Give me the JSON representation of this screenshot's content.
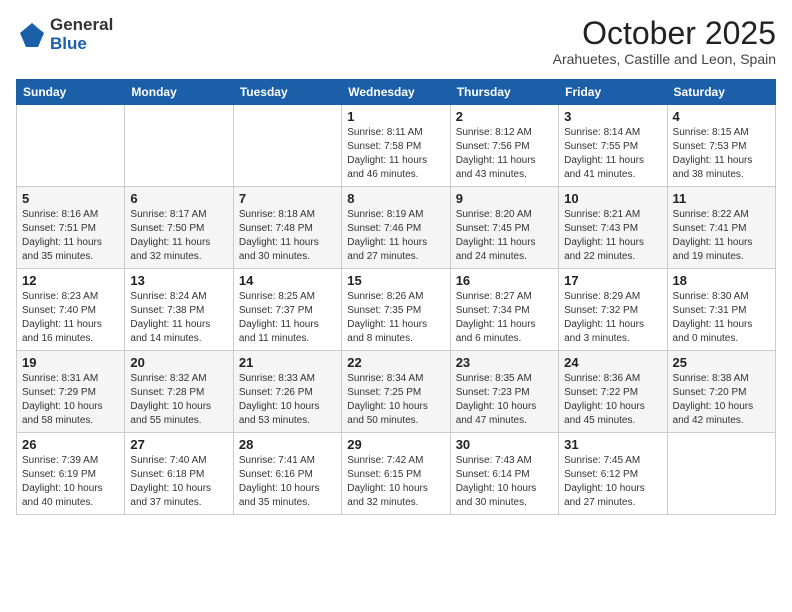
{
  "header": {
    "logo_general": "General",
    "logo_blue": "Blue",
    "month_title": "October 2025",
    "location": "Arahuetes, Castille and Leon, Spain"
  },
  "weekdays": [
    "Sunday",
    "Monday",
    "Tuesday",
    "Wednesday",
    "Thursday",
    "Friday",
    "Saturday"
  ],
  "weeks": [
    [
      {
        "day": "",
        "text": ""
      },
      {
        "day": "",
        "text": ""
      },
      {
        "day": "",
        "text": ""
      },
      {
        "day": "1",
        "text": "Sunrise: 8:11 AM\nSunset: 7:58 PM\nDaylight: 11 hours\nand 46 minutes."
      },
      {
        "day": "2",
        "text": "Sunrise: 8:12 AM\nSunset: 7:56 PM\nDaylight: 11 hours\nand 43 minutes."
      },
      {
        "day": "3",
        "text": "Sunrise: 8:14 AM\nSunset: 7:55 PM\nDaylight: 11 hours\nand 41 minutes."
      },
      {
        "day": "4",
        "text": "Sunrise: 8:15 AM\nSunset: 7:53 PM\nDaylight: 11 hours\nand 38 minutes."
      }
    ],
    [
      {
        "day": "5",
        "text": "Sunrise: 8:16 AM\nSunset: 7:51 PM\nDaylight: 11 hours\nand 35 minutes."
      },
      {
        "day": "6",
        "text": "Sunrise: 8:17 AM\nSunset: 7:50 PM\nDaylight: 11 hours\nand 32 minutes."
      },
      {
        "day": "7",
        "text": "Sunrise: 8:18 AM\nSunset: 7:48 PM\nDaylight: 11 hours\nand 30 minutes."
      },
      {
        "day": "8",
        "text": "Sunrise: 8:19 AM\nSunset: 7:46 PM\nDaylight: 11 hours\nand 27 minutes."
      },
      {
        "day": "9",
        "text": "Sunrise: 8:20 AM\nSunset: 7:45 PM\nDaylight: 11 hours\nand 24 minutes."
      },
      {
        "day": "10",
        "text": "Sunrise: 8:21 AM\nSunset: 7:43 PM\nDaylight: 11 hours\nand 22 minutes."
      },
      {
        "day": "11",
        "text": "Sunrise: 8:22 AM\nSunset: 7:41 PM\nDaylight: 11 hours\nand 19 minutes."
      }
    ],
    [
      {
        "day": "12",
        "text": "Sunrise: 8:23 AM\nSunset: 7:40 PM\nDaylight: 11 hours\nand 16 minutes."
      },
      {
        "day": "13",
        "text": "Sunrise: 8:24 AM\nSunset: 7:38 PM\nDaylight: 11 hours\nand 14 minutes."
      },
      {
        "day": "14",
        "text": "Sunrise: 8:25 AM\nSunset: 7:37 PM\nDaylight: 11 hours\nand 11 minutes."
      },
      {
        "day": "15",
        "text": "Sunrise: 8:26 AM\nSunset: 7:35 PM\nDaylight: 11 hours\nand 8 minutes."
      },
      {
        "day": "16",
        "text": "Sunrise: 8:27 AM\nSunset: 7:34 PM\nDaylight: 11 hours\nand 6 minutes."
      },
      {
        "day": "17",
        "text": "Sunrise: 8:29 AM\nSunset: 7:32 PM\nDaylight: 11 hours\nand 3 minutes."
      },
      {
        "day": "18",
        "text": "Sunrise: 8:30 AM\nSunset: 7:31 PM\nDaylight: 11 hours\nand 0 minutes."
      }
    ],
    [
      {
        "day": "19",
        "text": "Sunrise: 8:31 AM\nSunset: 7:29 PM\nDaylight: 10 hours\nand 58 minutes."
      },
      {
        "day": "20",
        "text": "Sunrise: 8:32 AM\nSunset: 7:28 PM\nDaylight: 10 hours\nand 55 minutes."
      },
      {
        "day": "21",
        "text": "Sunrise: 8:33 AM\nSunset: 7:26 PM\nDaylight: 10 hours\nand 53 minutes."
      },
      {
        "day": "22",
        "text": "Sunrise: 8:34 AM\nSunset: 7:25 PM\nDaylight: 10 hours\nand 50 minutes."
      },
      {
        "day": "23",
        "text": "Sunrise: 8:35 AM\nSunset: 7:23 PM\nDaylight: 10 hours\nand 47 minutes."
      },
      {
        "day": "24",
        "text": "Sunrise: 8:36 AM\nSunset: 7:22 PM\nDaylight: 10 hours\nand 45 minutes."
      },
      {
        "day": "25",
        "text": "Sunrise: 8:38 AM\nSunset: 7:20 PM\nDaylight: 10 hours\nand 42 minutes."
      }
    ],
    [
      {
        "day": "26",
        "text": "Sunrise: 7:39 AM\nSunset: 6:19 PM\nDaylight: 10 hours\nand 40 minutes."
      },
      {
        "day": "27",
        "text": "Sunrise: 7:40 AM\nSunset: 6:18 PM\nDaylight: 10 hours\nand 37 minutes."
      },
      {
        "day": "28",
        "text": "Sunrise: 7:41 AM\nSunset: 6:16 PM\nDaylight: 10 hours\nand 35 minutes."
      },
      {
        "day": "29",
        "text": "Sunrise: 7:42 AM\nSunset: 6:15 PM\nDaylight: 10 hours\nand 32 minutes."
      },
      {
        "day": "30",
        "text": "Sunrise: 7:43 AM\nSunset: 6:14 PM\nDaylight: 10 hours\nand 30 minutes."
      },
      {
        "day": "31",
        "text": "Sunrise: 7:45 AM\nSunset: 6:12 PM\nDaylight: 10 hours\nand 27 minutes."
      },
      {
        "day": "",
        "text": ""
      }
    ]
  ]
}
